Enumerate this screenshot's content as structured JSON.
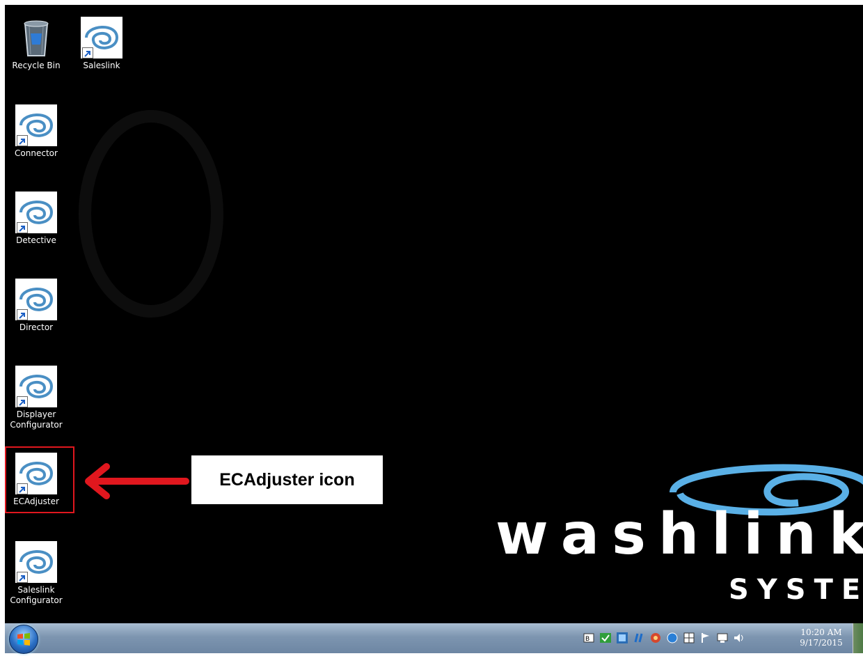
{
  "desktop": {
    "icons": [
      {
        "label": "Recycle Bin",
        "icon": "recycle-bin-icon"
      },
      {
        "label": "Saleslink",
        "icon": "washlink-swirl-icon"
      },
      {
        "label": "Connector",
        "icon": "washlink-swirl-icon"
      },
      {
        "label": "Detective",
        "icon": "washlink-swirl-icon"
      },
      {
        "label": "Director",
        "icon": "washlink-swirl-icon"
      },
      {
        "label": "Displayer Configurator",
        "icon": "washlink-swirl-icon"
      },
      {
        "label": "ECAdjuster",
        "icon": "washlink-swirl-icon"
      },
      {
        "label": "Saleslink Configurator",
        "icon": "washlink-swirl-icon"
      }
    ],
    "wallpaper": {
      "logo_word": "washlink",
      "logo_sub": "SYSTEM"
    }
  },
  "annotation": {
    "callout": "ECAdjuster icon",
    "color": "#e0171e"
  },
  "taskbar": {
    "tray_icons": [
      "language-icon",
      "green-check-icon",
      "blue-app-icon",
      "network-activity-icon",
      "red-app-icon",
      "blue-globe-icon",
      "windows-grid-icon",
      "flag-icon",
      "display-icon",
      "volume-icon"
    ],
    "time": "10:20 AM",
    "date": "9/17/2015"
  }
}
